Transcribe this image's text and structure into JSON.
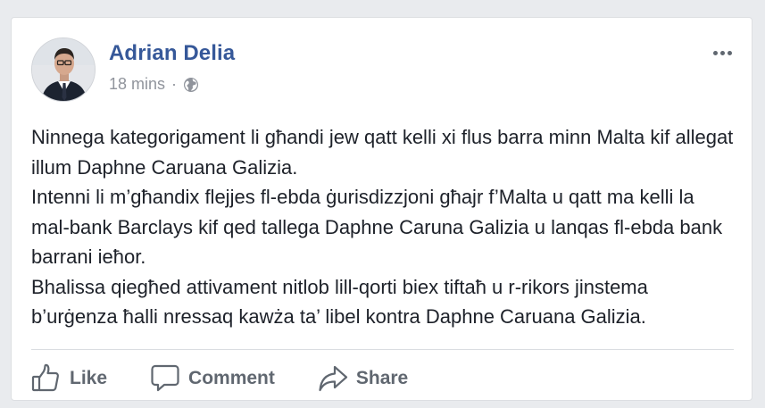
{
  "post": {
    "author": "Adrian Delia",
    "time": "18 mins",
    "separator": "·",
    "audience_icon": "globe-icon",
    "more_icon": "more-options-icon",
    "paragraphs": [
      "Ninnega kategorigament li għandi jew qatt kelli xi flus barra minn Malta kif allegat illum Daphne Caruana Galizia.",
      "Intenni li m’għandix flejjes fl-ebda ġurisdizzjoni għajr f’Malta u qatt ma kelli la mal-bank Barclays kif qed tallega Daphne Caruna Galizia u lanqas fl-ebda bank barrani ieħor.",
      "Bhalissa qiegħed attivament nitlob lill-qorti biex tiftaħ u r-rikors jinstema b’urġenza ħalli nressaq kawża ta’ libel kontra Daphne Caruana Galizia."
    ]
  },
  "actions": {
    "like_label": "Like",
    "comment_label": "Comment",
    "share_label": "Share"
  },
  "colors": {
    "author_link": "#365899",
    "muted_text": "#90949c",
    "action_text": "#606770",
    "card_border": "#dddfe2",
    "page_background": "#e9ebee"
  }
}
